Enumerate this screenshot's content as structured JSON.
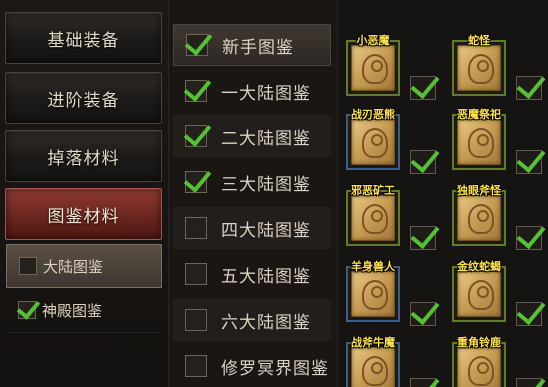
{
  "categories": [
    {
      "label": "基础装备",
      "active": false
    },
    {
      "label": "进阶装备",
      "active": false
    },
    {
      "label": "掉落材料",
      "active": false
    },
    {
      "label": "图鉴材料",
      "active": true
    }
  ],
  "sub_items": [
    {
      "label": "大陆图鉴",
      "checked": false,
      "selected": true
    },
    {
      "label": "神殿图鉴",
      "checked": true,
      "selected": false
    }
  ],
  "map_list": [
    {
      "label": "新手图鉴",
      "checked": true
    },
    {
      "label": "一大陆图鉴",
      "checked": true
    },
    {
      "label": "二大陆图鉴",
      "checked": true
    },
    {
      "label": "三大陆图鉴",
      "checked": true
    },
    {
      "label": "四大陆图鉴",
      "checked": false
    },
    {
      "label": "五大陆图鉴",
      "checked": false
    },
    {
      "label": "六大陆图鉴",
      "checked": false
    },
    {
      "label": "修罗冥界图鉴",
      "checked": false
    }
  ],
  "items": [
    {
      "name": "小恶魔",
      "checked": true,
      "border": "green"
    },
    {
      "name": "蛇怪",
      "checked": true,
      "border": "green"
    },
    {
      "name": "战刃恶熊",
      "checked": true,
      "border": "blue"
    },
    {
      "name": "恶魔祭祀",
      "checked": true,
      "border": "green"
    },
    {
      "name": "邪恶矿工",
      "checked": true,
      "border": "green"
    },
    {
      "name": "独眼斧怪",
      "checked": true,
      "border": "green"
    },
    {
      "name": "羊身兽人",
      "checked": true,
      "border": "blue"
    },
    {
      "name": "金纹蛇蝎",
      "checked": true,
      "border": "green"
    },
    {
      "name": "战斧牛魔",
      "checked": true,
      "border": "blue"
    },
    {
      "name": "重角铃鹿",
      "checked": true,
      "border": "green"
    }
  ],
  "colors": {
    "check": "#55c033",
    "item_name": "#ffe24a",
    "active_category": "#7a2d26"
  }
}
